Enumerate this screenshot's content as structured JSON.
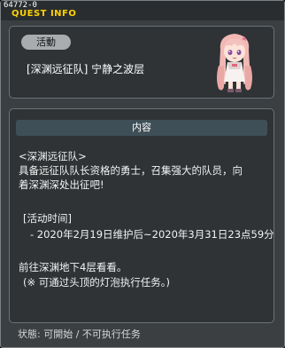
{
  "window": {
    "id": "64772-0",
    "title": "QUEST INFO"
  },
  "event": {
    "badge": "活動",
    "name": "[深渊远征队] 宁静之波层"
  },
  "content": {
    "header": "内容",
    "lines": [
      "<深渊远征队>",
      "具备远征队队长资格的勇士，召集强大的队员，向",
      "着深渊深处出征吧!",
      "[活动时间]",
      "- 2020年2月19日维护后~2020年3月31日23点59分",
      "前往深渊地下4层看看。",
      "(※ 可通过头顶的灯泡执行任务。)"
    ]
  },
  "status": {
    "text": "状態: 可開始 / 不可执行任务"
  },
  "colors": {
    "title": "#ffd200",
    "panel_bg": "#2f3336",
    "window_bg": "#3b3f42",
    "header_bg": "#3f4f57",
    "badge_bg": "#a8acae"
  }
}
